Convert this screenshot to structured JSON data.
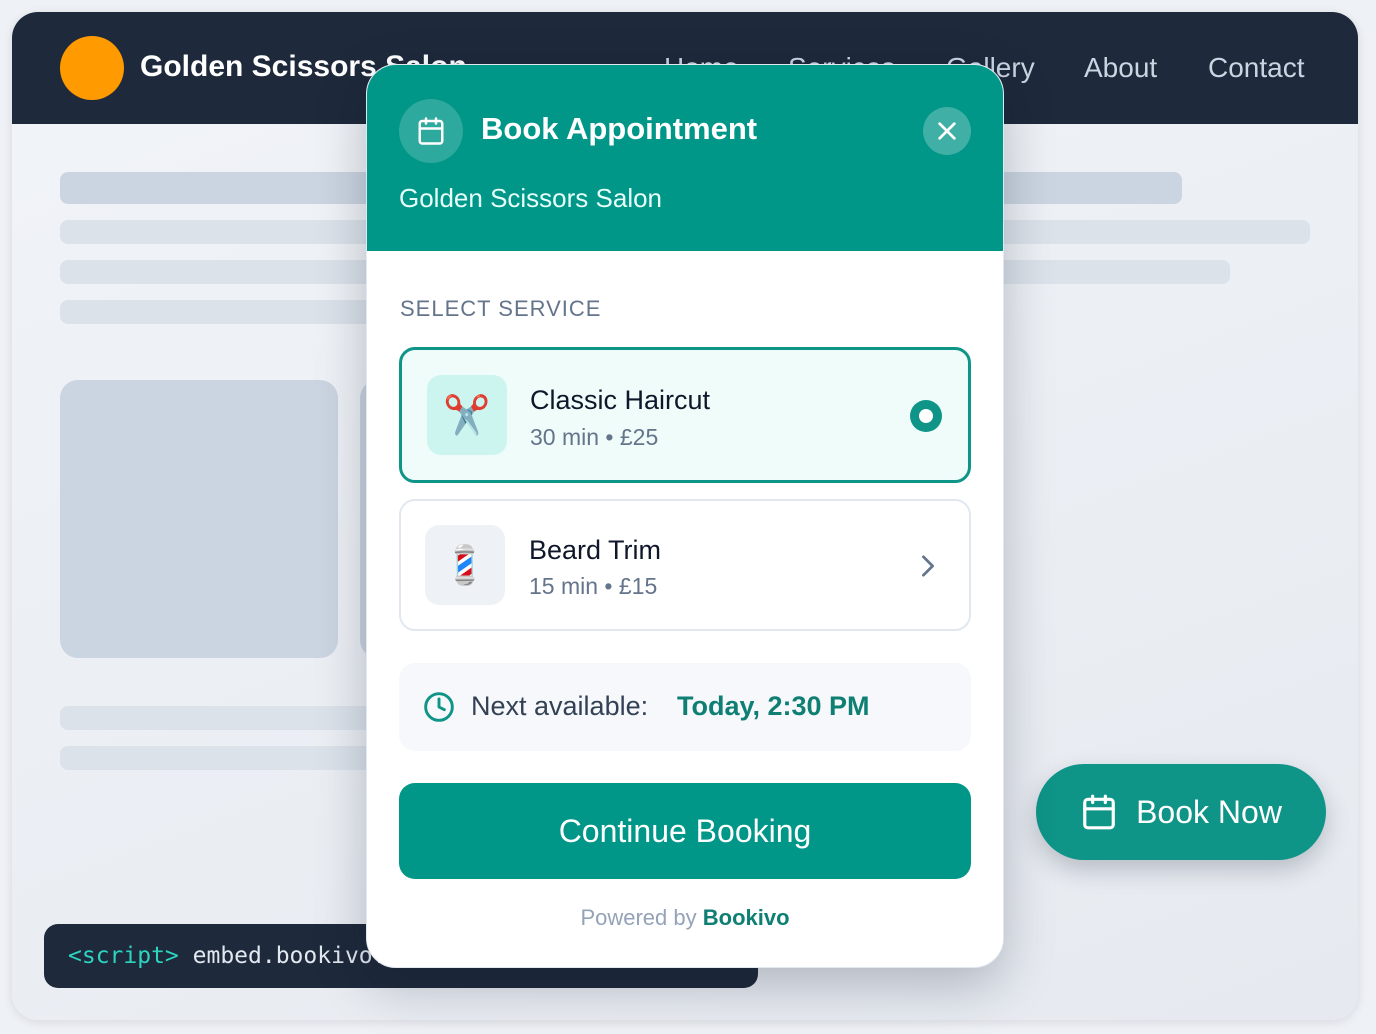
{
  "site": {
    "name": "Golden Scissors Salon",
    "nav": [
      "Home",
      "Services",
      "Gallery",
      "About",
      "Contact"
    ],
    "embed_code": {
      "tag": "<script>",
      "text": " embed.bookivo.com"
    }
  },
  "floating_button": {
    "label": "Book Now",
    "icon": "calendar-icon"
  },
  "modal": {
    "title": "Book Appointment",
    "subtitle": "Golden Scissors Salon",
    "section_label": "SELECT SERVICE",
    "services": [
      {
        "name": "Classic Haircut",
        "meta": "30 min • £25",
        "icon": "✂️",
        "selected": true
      },
      {
        "name": "Beard Trim",
        "meta": "15 min • £15",
        "icon": "💈",
        "selected": false
      }
    ],
    "next_available": {
      "label": "Next available:",
      "value": "Today, 2:30 PM"
    },
    "cta_label": "Continue Booking",
    "powered_by": {
      "prefix": "Powered by ",
      "brand": "Bookivo"
    }
  },
  "colors": {
    "accent": "#009688",
    "accent_dark": "#0f7f74",
    "nav_bg": "#1e293b",
    "logo": "#ff9a00"
  }
}
